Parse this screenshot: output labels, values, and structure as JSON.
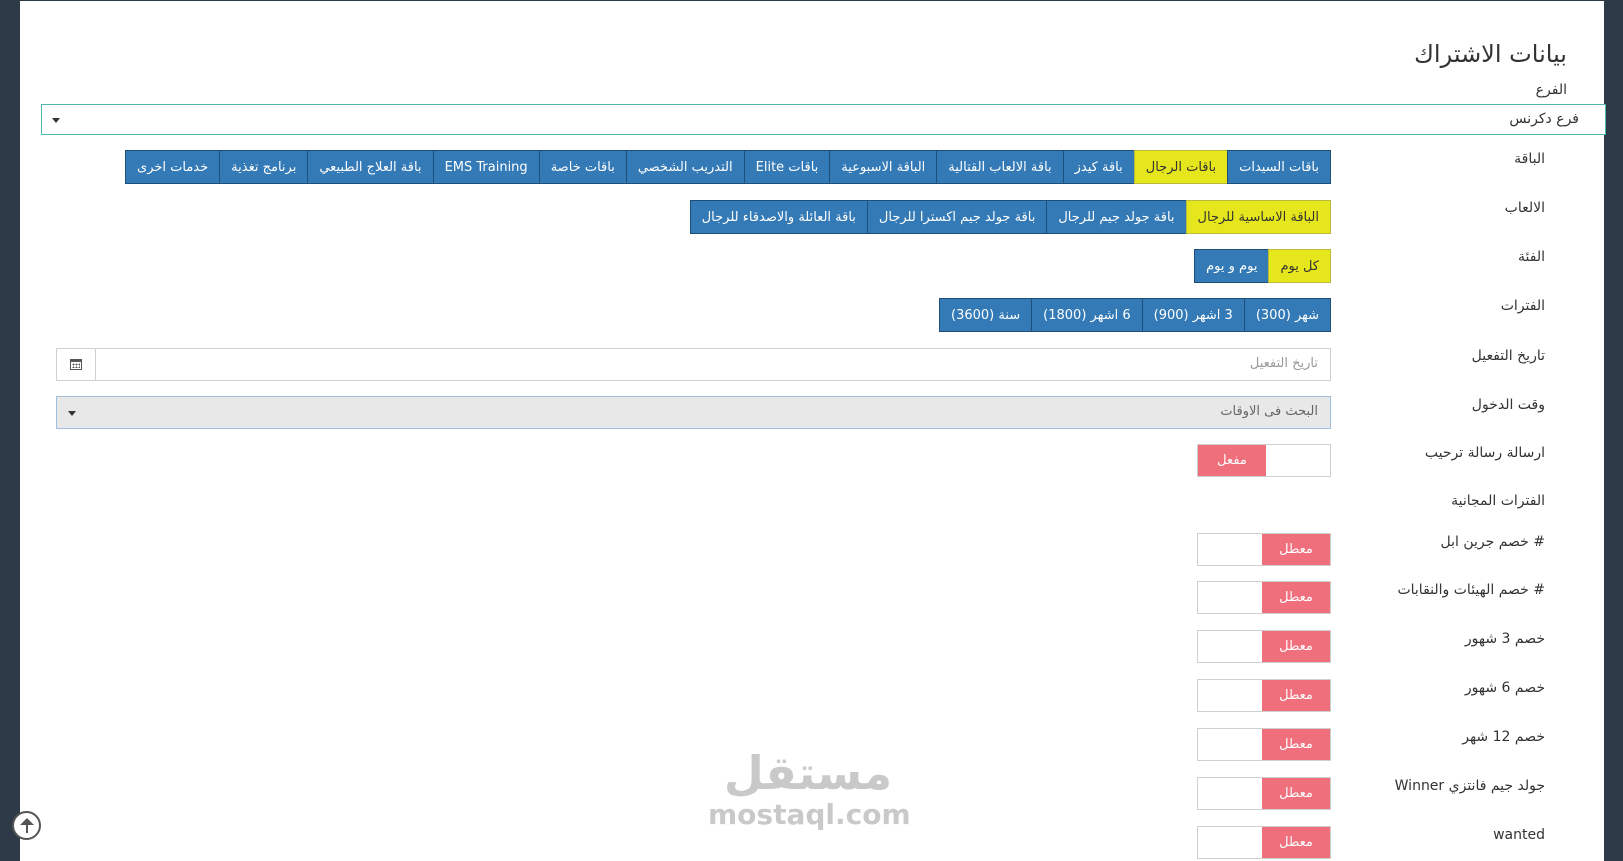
{
  "page_title": "بيانات الاشتراك",
  "branch": {
    "label": "الفرع",
    "selected": "فرع دكرنس"
  },
  "package": {
    "label": "الباقة",
    "options": [
      {
        "label": "باقات السيدات",
        "active": false
      },
      {
        "label": "باقات الرجال",
        "active": true
      },
      {
        "label": "باقة كيدز",
        "active": false
      },
      {
        "label": "باقة الالعاب القتالية",
        "active": false
      },
      {
        "label": "الباقة الاسبوعية",
        "active": false
      },
      {
        "label": "باقات Elite",
        "active": false
      },
      {
        "label": "التدريب الشخصي",
        "active": false
      },
      {
        "label": "باقات خاصة",
        "active": false
      },
      {
        "label": "EMS Training",
        "active": false
      },
      {
        "label": "باقة العلاج الطبيعي",
        "active": false
      },
      {
        "label": "برنامج تغذية",
        "active": false
      },
      {
        "label": "خدمات اخرى",
        "active": false
      }
    ]
  },
  "games": {
    "label": "الالعاب",
    "options": [
      {
        "label": "الباقة الاساسية للرجال",
        "active": true
      },
      {
        "label": "باقة جولد جيم للرجال",
        "active": false
      },
      {
        "label": "باقة جولد جيم اكسترا للرجال",
        "active": false
      },
      {
        "label": "باقة العائلة والاصدقاء للرجال",
        "active": false
      }
    ]
  },
  "category": {
    "label": "الفئة",
    "options": [
      {
        "label": "كل يوم",
        "active": true
      },
      {
        "label": "يوم و يوم",
        "active": false
      }
    ]
  },
  "periods": {
    "label": "الفترات",
    "options": [
      {
        "label": "شهر (300)",
        "active": false
      },
      {
        "label": "3 اشهر (900)",
        "active": false
      },
      {
        "label": "6 اشهر (1800)",
        "active": false
      },
      {
        "label": "سنة (3600)",
        "active": false
      }
    ]
  },
  "activation_date": {
    "label": "تاريخ التفعيل",
    "placeholder": "تاريخ التفعيل",
    "icon": "calendar-icon"
  },
  "entry_time": {
    "label": "وقت الدخول",
    "placeholder": "البحث فى الاوقات"
  },
  "welcome_message": {
    "label": "ارسالة رسالة ترحيب",
    "state": "مفعل",
    "enabled": true
  },
  "free_periods": {
    "label": "الفترات المجانية"
  },
  "discounts": [
    {
      "label": "# خصم جرين ابل",
      "state": "معطل",
      "enabled": false
    },
    {
      "label": "# خصم الهيئات والنقابات",
      "state": "معطل",
      "enabled": false
    },
    {
      "label": "خصم 3 شهور",
      "state": "معطل",
      "enabled": false
    },
    {
      "label": "خصم 6 شهور",
      "state": "معطل",
      "enabled": false
    },
    {
      "label": "خصم 12 شهر",
      "state": "معطل",
      "enabled": false
    },
    {
      "label": "جولد جيم فانتزي Winner",
      "state": "معطل",
      "enabled": false
    },
    {
      "label": "wanted",
      "state": "معطل",
      "enabled": false
    }
  ],
  "watermark": {
    "arabic": "مستقل",
    "latin": "mostaql.com"
  },
  "colors": {
    "primary": "#337ab7",
    "active": "#e6e61c",
    "toggle": "#ef6f7c",
    "sidebar": "#2e3a48"
  }
}
